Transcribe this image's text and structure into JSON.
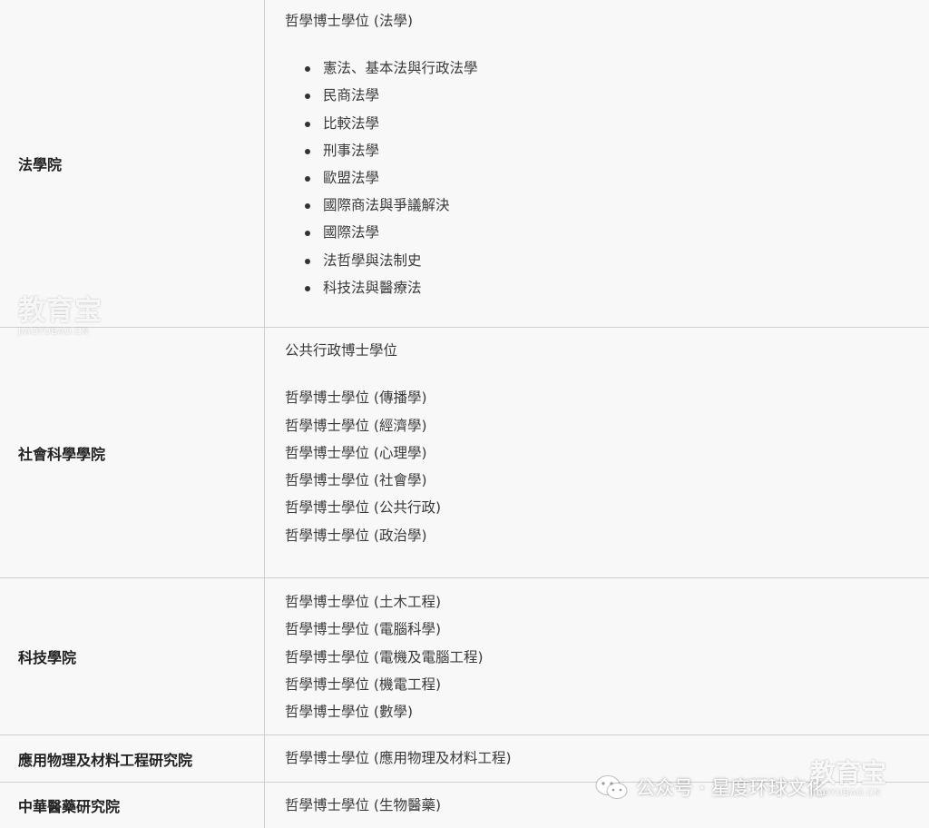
{
  "rows": [
    {
      "faculty": "法學院",
      "intro": "哲學博士學位 (法學)",
      "bullets": [
        "憲法、基本法與行政法學",
        "民商法學",
        "比較法學",
        "刑事法學",
        "歐盟法學",
        "國際商法與爭議解決",
        "國際法學",
        "法哲學與法制史",
        "科技法與醫療法"
      ]
    },
    {
      "faculty": "社會科學學院",
      "intro": "公共行政博士學位",
      "lines": [
        "哲學博士學位 (傳播學)",
        "哲學博士學位 (經濟學)",
        "哲學博士學位 (心理學)",
        "哲學博士學位 (社會學)",
        "哲學博士學位 (公共行政)",
        "哲學博士學位 (政治學)"
      ]
    },
    {
      "faculty": "科技學院",
      "lines": [
        "哲學博士學位 (土木工程)",
        "哲學博士學位 (電腦科學)",
        "哲學博士學位 (電機及電腦工程)",
        "哲學博士學位 (機電工程)",
        "哲學博士學位 (數學)"
      ]
    },
    {
      "faculty": "應用物理及材料工程研究院",
      "lines": [
        "哲學博士學位 (應用物理及材料工程)"
      ]
    },
    {
      "faculty": "中華醫藥研究院",
      "lines": [
        "哲學博士學位 (生物醫藥)"
      ]
    }
  ],
  "watermark": {
    "logo_cn": "教育宝",
    "logo_en": "JIAOYUBAO.CN",
    "wechat_text": "公众号 · 星度环球文化",
    "wechat_icon": "wechat-icon"
  }
}
